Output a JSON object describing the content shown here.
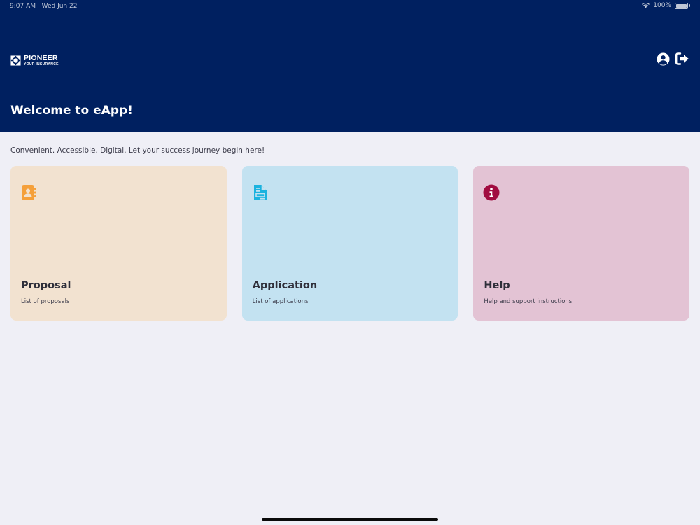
{
  "status_bar": {
    "time": "9:07 AM",
    "date": "Wed Jun 22",
    "battery": "100%"
  },
  "brand": {
    "name": "PIONEER",
    "tagline": "YOUR INSURANCE"
  },
  "header": {
    "welcome": "Welcome to eApp!"
  },
  "tagline": "Convenient. Accessible. Digital. Let your success journey begin here!",
  "cards": [
    {
      "title": "Proposal",
      "subtitle": "List of proposals",
      "icon": "contact-book-icon",
      "bg": "#f2e2d0",
      "icon_color": "#f5a03a"
    },
    {
      "title": "Application",
      "subtitle": "List of applications",
      "icon": "document-icon",
      "bg": "#c3e2f1",
      "icon_color": "#1bb3df"
    },
    {
      "title": "Help",
      "subtitle": "Help and support instructions",
      "icon": "info-icon",
      "bg": "#e3c3d4",
      "icon_color": "#a10c40"
    }
  ],
  "colors": {
    "header_bg": "#002060",
    "page_bg": "#efeff6"
  }
}
